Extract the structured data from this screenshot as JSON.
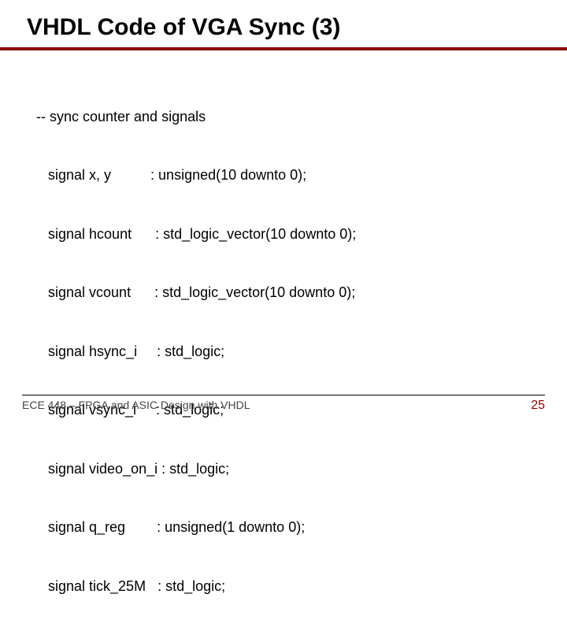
{
  "title": "VHDL Code of VGA Sync (3)",
  "code": {
    "comment": "-- sync counter and signals",
    "lines": [
      "   signal x, y          : unsigned(10 downto 0);",
      "   signal hcount      : std_logic_vector(10 downto 0);",
      "   signal vcount      : std_logic_vector(10 downto 0);",
      "   signal hsync_i     : std_logic;",
      "   signal vsync_i     : std_logic;",
      "   signal video_on_i : std_logic;",
      "   signal q_reg        : unsigned(1 downto 0);",
      "   signal tick_25M   : std_logic;"
    ]
  },
  "footer": {
    "left": "ECE 448 – FPGA and ASIC Design with VHDL",
    "page": "25"
  }
}
